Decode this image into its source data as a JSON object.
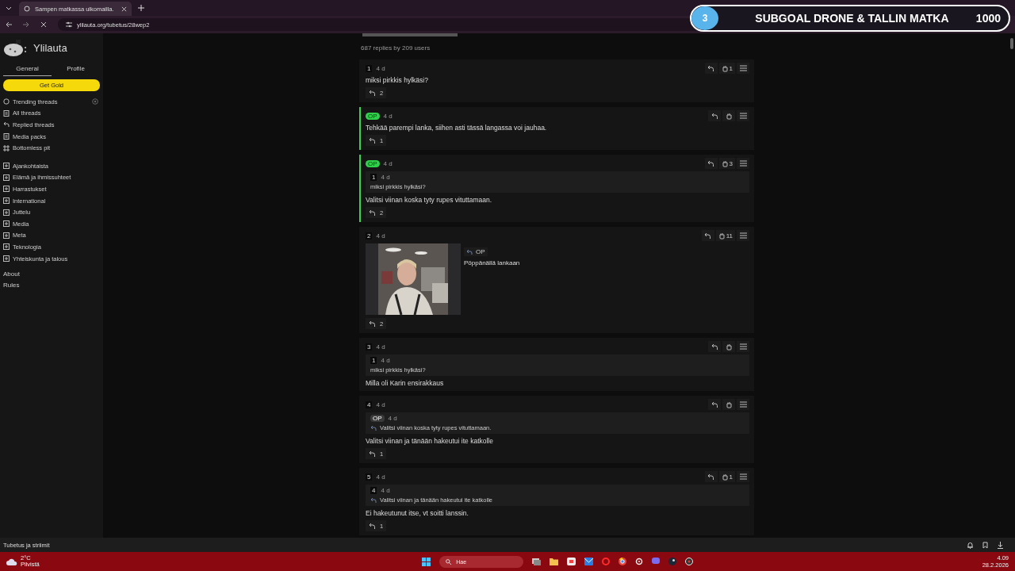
{
  "browser": {
    "tab_title": "Sampen matkassa ulkomailla.",
    "url": "ylilauta.org/tubetus/28wep2"
  },
  "overlay": {
    "number": "3",
    "title": "SUBGOAL DRONE & TALLIN MATKA",
    "target": "1000"
  },
  "sidebar": {
    "logo": "Ylilauta",
    "tabs": [
      {
        "label": "General",
        "selected": true
      },
      {
        "label": "Profile",
        "selected": false
      }
    ],
    "gold_button": "Get Gold",
    "nav": [
      {
        "label": "Trending threads",
        "kind": "trending"
      },
      {
        "label": "All threads",
        "kind": "doc"
      },
      {
        "label": "Replied threads",
        "kind": "reply"
      },
      {
        "label": "Media packs",
        "kind": "doc"
      },
      {
        "label": "Bottomless pit",
        "kind": "grid"
      }
    ],
    "boards": [
      "Ajankohtaista",
      "Elämä ja ihmissuhteet",
      "Harrastukset",
      "International",
      "Juttelu",
      "Media",
      "Meta",
      "Teknologia",
      "Yhteiskunta ja talous"
    ],
    "links": [
      "About",
      "Rules"
    ]
  },
  "thread": {
    "stats": "687 replies by 209 users",
    "posts": [
      {
        "number": "1",
        "op": false,
        "time": "4 d",
        "likes": "1",
        "text": "miksi pirkkis hylkäsi?",
        "replies": "2"
      },
      {
        "number": "OP",
        "op": true,
        "time": "4 d",
        "text": "Tehkää parempi lanka, siihen asti tässä langassa voi jauhaa.",
        "replies": "1"
      },
      {
        "number": "OP",
        "op": true,
        "time": "4 d",
        "likes": "3",
        "quote": {
          "ref": "1",
          "ref_op": false,
          "time": "4 d",
          "arrow": false,
          "text": "miksi pirkkis hylkäsi?"
        },
        "text": "Valitsi viinan koska tyty rupes vituttamaan.",
        "replies": "2"
      },
      {
        "number": "2",
        "op": false,
        "time": "4 d",
        "likes": "11",
        "reply_to": "OP",
        "text": "Pöppänällä lankaan",
        "replies": "2"
      },
      {
        "number": "3",
        "op": false,
        "time": "4 d",
        "quote": {
          "ref": "1",
          "ref_op": false,
          "time": "4 d",
          "arrow": false,
          "text": "miksi pirkkis hylkäsi?"
        },
        "text": "Milla oli Karin ensirakkaus"
      },
      {
        "number": "4",
        "op": false,
        "time": "4 d",
        "quote": {
          "ref": "OP",
          "ref_op": true,
          "time": "4 d",
          "arrow": true,
          "text": "Valitsi viinan koska tyty rupes vituttamaan."
        },
        "text": "Valitsi viinan ja tänään hakeutui ite katkolle",
        "replies": "1"
      },
      {
        "number": "5",
        "op": false,
        "time": "4 d",
        "likes": "1",
        "quote": {
          "ref": "4",
          "ref_op": false,
          "time": "4 d",
          "arrow": true,
          "text": "Valitsi viinan ja tänään hakeutui ite katkolle"
        },
        "text": "Ei hakeutunut itse, vt soitti lanssin.",
        "replies": "1"
      }
    ]
  },
  "status_strip": "Tubetus ja striimit",
  "taskbar": {
    "temperature": "2°C",
    "weather": "Pilvistä",
    "search": "Hae",
    "time": "4.09",
    "date": "28.2.2026"
  }
}
